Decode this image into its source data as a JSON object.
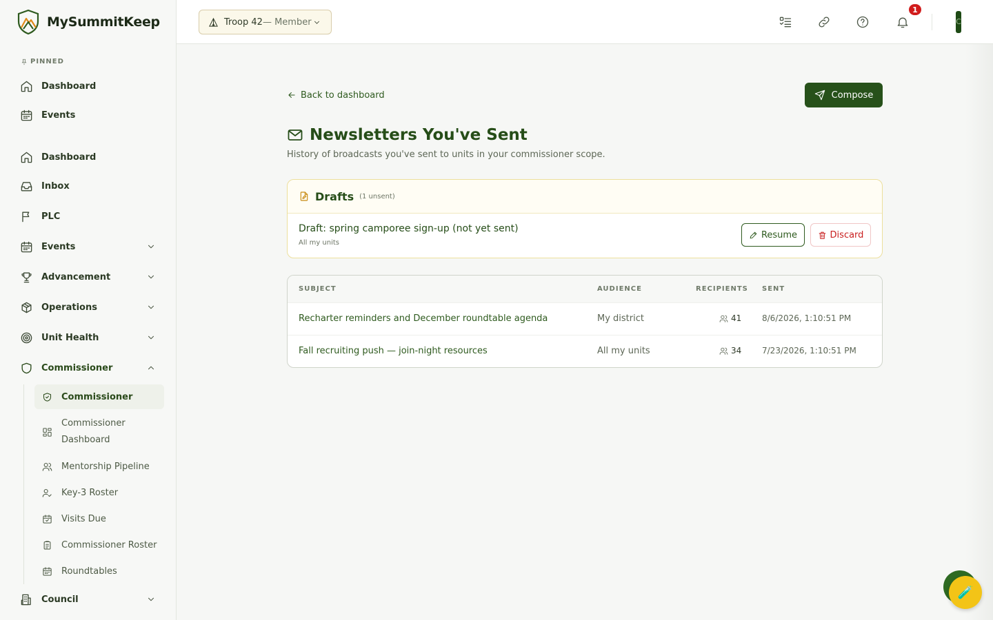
{
  "brand": {
    "name": "MySummitKeep"
  },
  "sidebar": {
    "pinned_label": "PINNED",
    "pinned": [
      {
        "label": "Dashboard",
        "icon": "home-icon"
      },
      {
        "label": "Events",
        "icon": "calendar-icon"
      }
    ],
    "items": [
      {
        "label": "Dashboard",
        "icon": "home-icon"
      },
      {
        "label": "Inbox",
        "icon": "inbox-icon"
      },
      {
        "label": "PLC",
        "icon": "flag-icon"
      },
      {
        "label": "Events",
        "icon": "calendar-icon",
        "expandable": true
      },
      {
        "label": "Advancement",
        "icon": "trophy-icon",
        "expandable": true
      },
      {
        "label": "Operations",
        "icon": "box-icon",
        "expandable": true
      },
      {
        "label": "Unit Health",
        "icon": "target-icon",
        "expandable": true
      },
      {
        "label": "Commissioner",
        "icon": "shield-icon",
        "expandable": true,
        "expanded": true
      },
      {
        "label": "Council",
        "icon": "building-icon",
        "expandable": true
      }
    ],
    "commissioner_sub": [
      {
        "label": "Commissioner",
        "icon": "shield-check-icon",
        "active": true
      },
      {
        "label": "Commissioner Dashboard",
        "icon": "grid-icon"
      },
      {
        "label": "Mentorship Pipeline",
        "icon": "users-icon"
      },
      {
        "label": "Key-3 Roster",
        "icon": "user-check-icon"
      },
      {
        "label": "Visits Due",
        "icon": "calendar-check-icon"
      },
      {
        "label": "Commissioner Roster",
        "icon": "clipboard-icon"
      },
      {
        "label": "Roundtables",
        "icon": "calendar-icon"
      }
    ]
  },
  "header": {
    "unit_name": "Troop 42",
    "unit_role": " — Member",
    "notification_count": "1",
    "avatar_initial": "C"
  },
  "main": {
    "back_label": "Back to dashboard",
    "compose_label": "Compose",
    "title": "Newsletters You've Sent",
    "subtitle": "History of broadcasts you've sent to units in your commissioner scope.",
    "drafts": {
      "title": "Drafts",
      "count": "(1 unsent)",
      "items": [
        {
          "subject": "Draft: spring camporee sign-up (not yet sent)",
          "audience": "All my units",
          "resume_label": "Resume",
          "discard_label": "Discard"
        }
      ]
    },
    "table": {
      "columns": [
        "SUBJECT",
        "AUDIENCE",
        "RECIPIENTS",
        "SENT"
      ],
      "rows": [
        {
          "subject": "Recharter reminders and December roundtable agenda",
          "audience": "My district",
          "recipients": "41",
          "sent": "8/6/2026, 1:10:51 PM"
        },
        {
          "subject": "Fall recruiting push — join-night resources",
          "audience": "All my units",
          "recipients": "34",
          "sent": "7/23/2026, 1:10:51 PM"
        }
      ]
    }
  },
  "colors": {
    "brand": "#27511a",
    "accent": "#c78a12",
    "danger": "#c81e1e",
    "fab": "#f3c417"
  }
}
